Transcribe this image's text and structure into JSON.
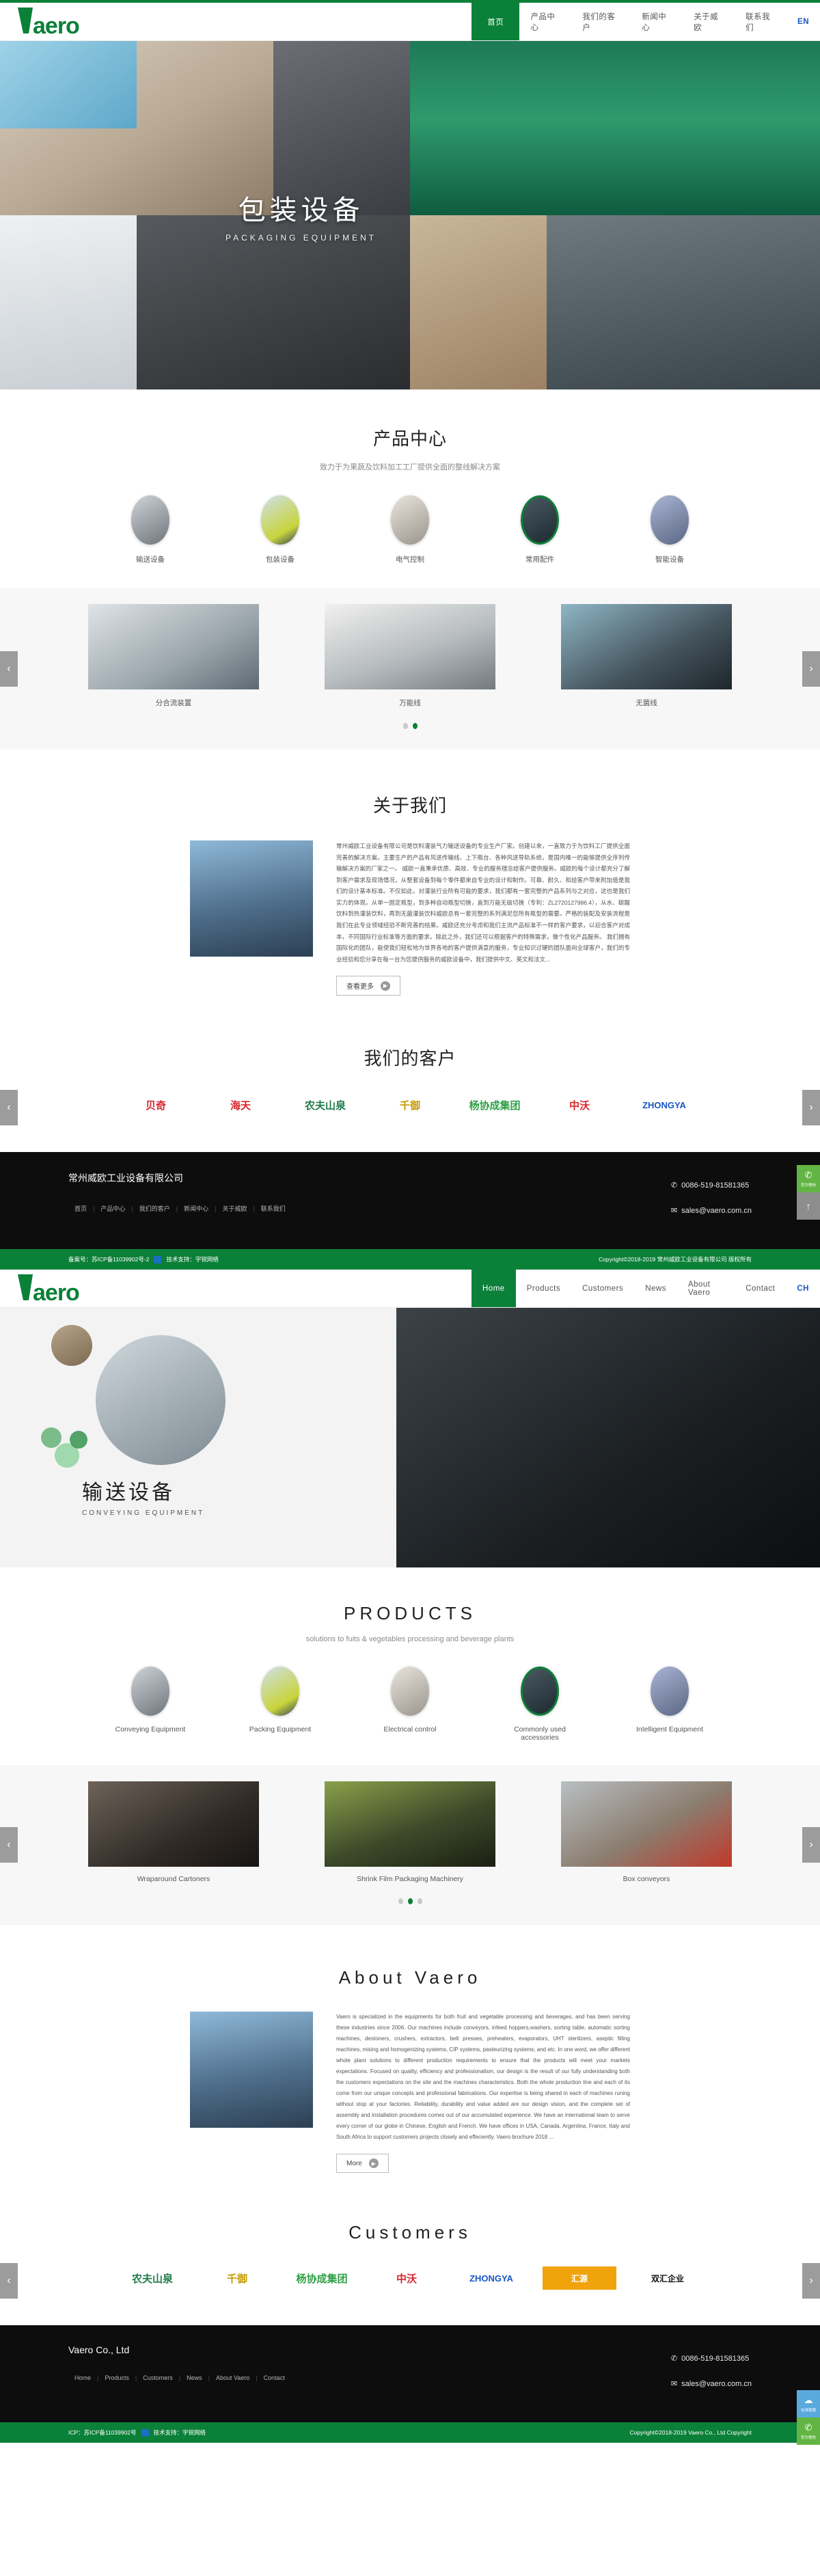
{
  "brand": {
    "name": "Vaero",
    "logo_letter": "V",
    "logo_rest": "aero",
    "green": "#0b8038"
  },
  "cn_page": {
    "nav": [
      {
        "label": "首页",
        "active": true
      },
      {
        "label": "产品中心",
        "active": false
      },
      {
        "label": "我们的客户",
        "active": false
      },
      {
        "label": "新闻中心",
        "active": false
      },
      {
        "label": "关于威欧",
        "active": false
      },
      {
        "label": "联系我们",
        "active": false
      },
      {
        "label": "EN",
        "active": false,
        "lang": true
      }
    ],
    "hero": {
      "title_cn": "包装设备",
      "title_en": "PACKAGING EQUIPMENT"
    },
    "products": {
      "title": "产品中心",
      "subtitle": "致力于为果蔬及饮料加工工厂提供全面的整线解决方案",
      "categories": [
        {
          "label": "输送设备",
          "icon": "conveying-equipment-icon",
          "highlight": false
        },
        {
          "label": "包装设备",
          "icon": "packing-equipment-icon",
          "highlight": false
        },
        {
          "label": "电气控制",
          "icon": "electrical-control-icon",
          "highlight": false
        },
        {
          "label": "常用配件",
          "icon": "accessories-icon",
          "highlight": true
        },
        {
          "label": "智能设备",
          "icon": "intelligent-equipment-icon",
          "highlight": false
        }
      ],
      "slides": [
        {
          "caption": "分合流装置"
        },
        {
          "caption": "万能线"
        },
        {
          "caption": "无菌线"
        }
      ],
      "dots": [
        false,
        true
      ],
      "prev": "‹",
      "next": "›"
    },
    "about": {
      "title": "关于我们",
      "body": "常州威欧工业设备有限公司是饮料灌装气力输送设备的专业生产厂家。创建以来，一直致力于为饮料工厂提供全面完善的解决方案。主要生产的产品有风送传输线、上下瓶台、各种风送导轨系统，是国内唯一的能够提供全序列传输解决方案的厂家之一。 威欧一直秉承优质、高效、专业的服务理念给客户提供服务。威欧的每个设计都充分了解到客户需求及现场情况，从整套设备到每个零件都来自专业的设计和制作。可靠、耐久、和给客户带来附加值是我们的设计基本标准。不仅如此，对灌装行业所有可能的要求，我们都有一套完整的产品系列与之对应，这也是我们实力的体现。从单一固定瓶型，到多种自动瓶型切换，直到万能无级切换（专利：ZL2720127986.4），从水、碳酸饮料到热灌装饮料，再到无菌灌装饮料威欧总有一套完整的系列满足您所有瓶型的需要。严格的装配及安装流程是我们在此专业领域经验不断完善的结果。威欧还充分考虑和我们主流产品标准不一样的客户要求，以迎合客户对成本，不同国际行业标准等方面的要求。除此之外，我们还可以根据客户的特殊需求，做个性化产品服务。 我们拥有国际化的团队，能使我们轻松地为世界各地的客户提供满意的服务，专业知识过硬的团队面向全球客户，我们的专业经验和您分享在每一台为您提供服务的威欧设备中，我们提供中文、英文和法文...",
      "more_label": "查看更多"
    },
    "customers": {
      "title": "我们的客户",
      "logos": [
        {
          "name": "贝奇",
          "color": "#d8252b"
        },
        {
          "name": "海天",
          "color": "#d8252b"
        },
        {
          "name": "农夫山泉",
          "color": "#1f7a4a"
        },
        {
          "name": "千御",
          "color": "#f5c518"
        },
        {
          "name": "杨协成集团",
          "color": "#2f9e44"
        },
        {
          "name": "中沃",
          "color": "#d8252b"
        },
        {
          "name": "ZHONGYA",
          "color": "#1a56c4"
        }
      ]
    },
    "footer": {
      "company": "常州威欧工业设备有限公司",
      "links": [
        "首页",
        "产品中心",
        "我们的客户",
        "新闻中心",
        "关于威欧",
        "联系我们"
      ],
      "phone": "0086-519-81581365",
      "email": "sales@vaero.com.cn",
      "icp": "备案号：苏ICP备11039902号-2",
      "tech": "技术支持：宇锐网络",
      "copyright": "Copyright©2018-2019 常州威欧工业设备有限公司 版权所有"
    },
    "side_widgets": [
      {
        "name": "wechat",
        "label": "官方微信"
      },
      {
        "name": "back-to-top",
        "label": "↑"
      }
    ]
  },
  "en_page": {
    "nav": [
      {
        "label": "Home",
        "active": true
      },
      {
        "label": "Products",
        "active": false
      },
      {
        "label": "Customers",
        "active": false
      },
      {
        "label": "News",
        "active": false
      },
      {
        "label": "About Vaero",
        "active": false
      },
      {
        "label": "Contact",
        "active": false
      },
      {
        "label": "CH",
        "active": false,
        "lang": true
      }
    ],
    "hero": {
      "title_cn": "输送设备",
      "title_en": "CONVEYING EQUIPMENT"
    },
    "products": {
      "title": "PRODUCTS",
      "subtitle": "solutions to fuits & vegetables processing and beverage plants",
      "categories": [
        {
          "label": "Conveying Equipment",
          "icon": "conveying-equipment-icon",
          "highlight": false
        },
        {
          "label": "Packing Equipment",
          "icon": "packing-equipment-icon",
          "highlight": false
        },
        {
          "label": "Electrical control",
          "icon": "electrical-control-icon",
          "highlight": false
        },
        {
          "label": "Commonly used accessories",
          "icon": "accessories-icon",
          "highlight": true
        },
        {
          "label": "Intelligent Equipment",
          "icon": "intelligent-equipment-icon",
          "highlight": false
        }
      ],
      "slides": [
        {
          "caption": "Wraparound Cartoners"
        },
        {
          "caption": "Shrink Film Packaging Machinery"
        },
        {
          "caption": "Box conveyors"
        }
      ],
      "dots": [
        false,
        true,
        false
      ],
      "prev": "‹",
      "next": "›"
    },
    "about": {
      "title": "About Vaero",
      "body": "Vaero is specialized in the equipments for both fruit and vegetable processing and beverages, and has been serving these industries since 2006. Our machines include conveyors, infeed hoppers,washers, sorting table, automatic sorting machines, destoners, crushers, extractors, belt presses, preheaters, evaporators, UHT sterilizers, aseptic filling machines, mixing and homogenizing systems, CIP systems, pasteurizing systems, and etc. In one word, we offer different whole plant solutions to different production requirements to ensure that the products will meet your markets expectations. Focused on quality, efficiency and professionalism, our design is the result of our fully understanding both the customers expectations on the site and the machines characteristics. Both the whole production line and each of its come from our unique concepts and professional fabrications. Our expertise is being shared in each of machines runing without stop at your factories. Reliability, durability and value added are our design vision, and the complete set of assembly and installation procedures comes out of our accumulated experience. We have an international team to serve every corner of our globe in Chinese, English and French. We have offices in USA, Canada, Argentina, France, Italy and South Africa to support customers projects closely and effeciently. Vaero brochure 2018 ...",
      "more_label": "More"
    },
    "customers": {
      "title": "Customers",
      "logos": [
        {
          "name": "农夫山泉",
          "color": "#1f7a4a"
        },
        {
          "name": "千御",
          "color": "#f5c518"
        },
        {
          "name": "杨协成集团",
          "color": "#2f9e44"
        },
        {
          "name": "中沃",
          "color": "#d8252b"
        },
        {
          "name": "ZHONGYA",
          "color": "#1a56c4"
        },
        {
          "name": "汇源",
          "color": "#e8a317"
        },
        {
          "name": "双汇企业",
          "color": "#111111"
        }
      ]
    },
    "footer": {
      "company": "Vaero Co., Ltd",
      "links": [
        "Home",
        "Products",
        "Customers",
        "News",
        "About Vaero",
        "Contact"
      ],
      "phone": "0086-519-81581365",
      "email": "sales@vaero.com.cn",
      "icp": "ICP：苏ICP备11039902号",
      "tech": "技术支持：宇锐网络",
      "copyright": "Copyright©2018-2019 Vaero Co., Ltd Copyright"
    },
    "side_widgets": [
      {
        "name": "online-service",
        "label": "在线客服"
      },
      {
        "name": "wechat",
        "label": "官方微信"
      }
    ]
  }
}
